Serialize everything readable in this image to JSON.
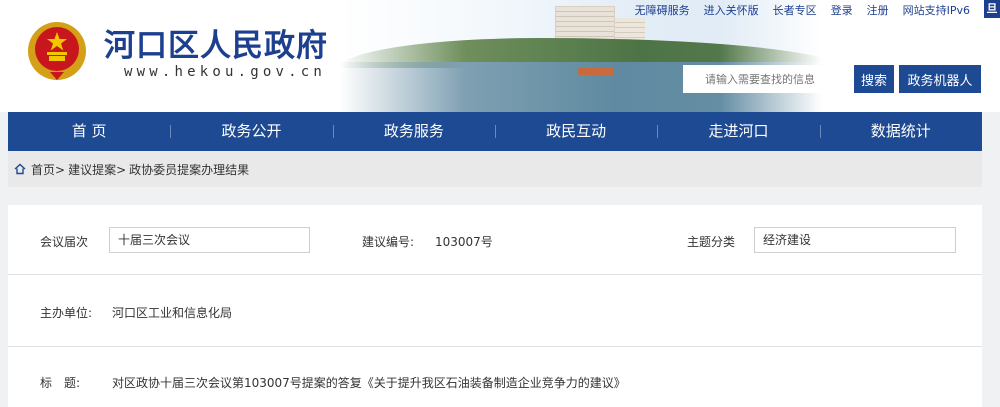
{
  "header": {
    "title": "河口区人民政府",
    "url": "www.hekou.gov.cn",
    "top_links": [
      "无障碍服务",
      "进入关怀版",
      "长者专区",
      "登录",
      "注册",
      "网站支持IPv6"
    ],
    "corner_badge": "旦",
    "search_placeholder": "请输入需要查找的信息",
    "search_button": "搜索",
    "robot_button": "政务机器人"
  },
  "nav": {
    "items": [
      "首 页",
      "政务公开",
      "政务服务",
      "政民互动",
      "走进河口",
      "数据统计"
    ]
  },
  "breadcrumb": {
    "items": [
      "首页>",
      "建议提案>",
      "政协委员提案办理结果"
    ]
  },
  "detail": {
    "session_label": "会议届次",
    "session_value": "十届三次会议",
    "number_label": "建议编号:",
    "number_value": "103007号",
    "topic_label": "主题分类",
    "topic_value": "经济建设",
    "host_label": "主办单位:",
    "host_value": "河口区工业和信息化局",
    "title_label": "标　题:",
    "title_value": "对区政协十届三次会议第103007号提案的答复《关于提升我区石油装备制造企业竞争力的建议》"
  },
  "colors": {
    "brand_blue": "#1d4a93",
    "title_blue": "#1d3f8f",
    "page_bg": "#f0f1f3"
  }
}
